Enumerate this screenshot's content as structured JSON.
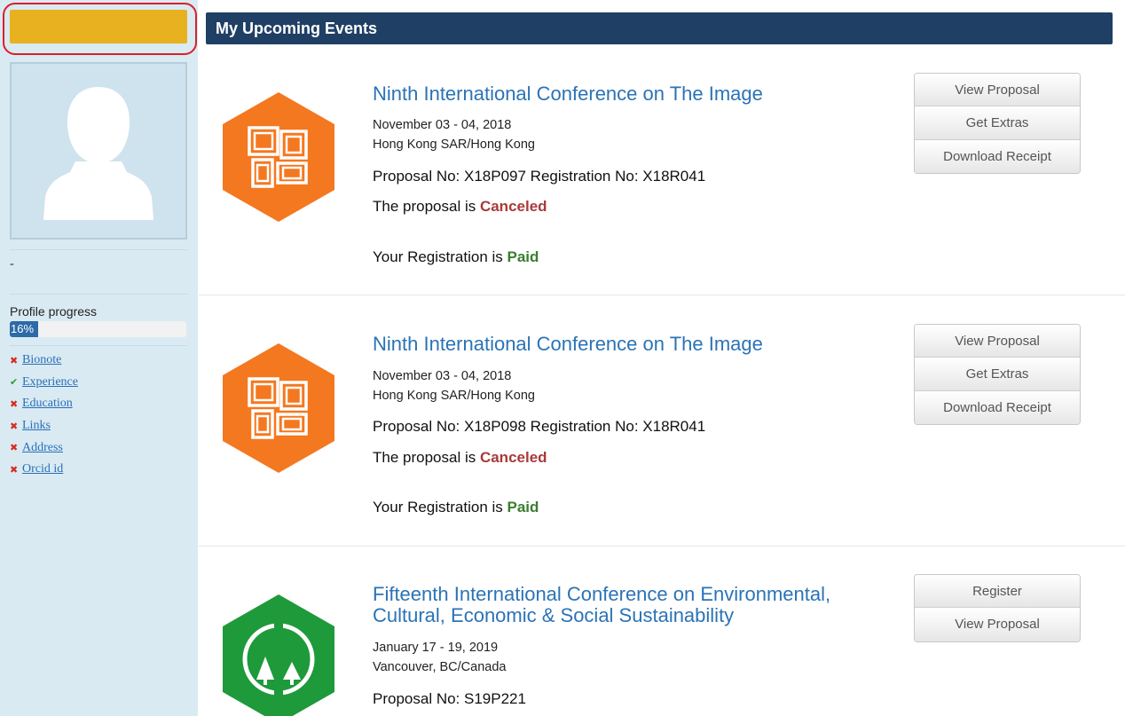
{
  "sidebar": {
    "name_placeholder": "",
    "dash": "-",
    "progress": {
      "label": "Profile progress",
      "value_text": "16%",
      "percent": 16
    },
    "checklist": [
      {
        "label": "Bionote",
        "done": false
      },
      {
        "label": "Experience",
        "done": true
      },
      {
        "label": "Education",
        "done": false
      },
      {
        "label": "Links",
        "done": false
      },
      {
        "label": "Address",
        "done": false
      },
      {
        "label": "Orcid id",
        "done": false
      }
    ]
  },
  "header": {
    "title": "My Upcoming Events"
  },
  "events": [
    {
      "title": "Ninth International Conference on The Image",
      "date": "November 03 - 04, 2018",
      "place": "Hong Kong SAR/Hong Kong",
      "numbers": "Proposal No: X18P097 Registration No: X18R041",
      "proposal_prefix": "The proposal is ",
      "proposal_status": "Canceled",
      "registration_prefix": "Your Registration is ",
      "registration_status": "Paid",
      "buttons": [
        "View Proposal",
        "Get Extras",
        "Download Receipt"
      ],
      "logo_color": "#f47820",
      "logo_icon": "image-frames-icon"
    },
    {
      "title": "Ninth International Conference on The Image",
      "date": "November 03 - 04, 2018",
      "place": "Hong Kong SAR/Hong Kong",
      "numbers": "Proposal No: X18P098 Registration No: X18R041",
      "proposal_prefix": "The proposal is ",
      "proposal_status": "Canceled",
      "registration_prefix": "Your Registration is ",
      "registration_status": "Paid",
      "buttons": [
        "View Proposal",
        "Get Extras",
        "Download Receipt"
      ],
      "logo_color": "#f47820",
      "logo_icon": "image-frames-icon"
    },
    {
      "title": "Fifteenth International Conference on Environmental, Cultural, Economic & Social Sustainability",
      "date": "January 17 - 19, 2019",
      "place": "Vancouver, BC/Canada",
      "numbers": "Proposal No: S19P221",
      "buttons": [
        "Register",
        "View Proposal"
      ],
      "logo_color": "#1e9a3a",
      "logo_icon": "trees-circle-icon"
    }
  ]
}
